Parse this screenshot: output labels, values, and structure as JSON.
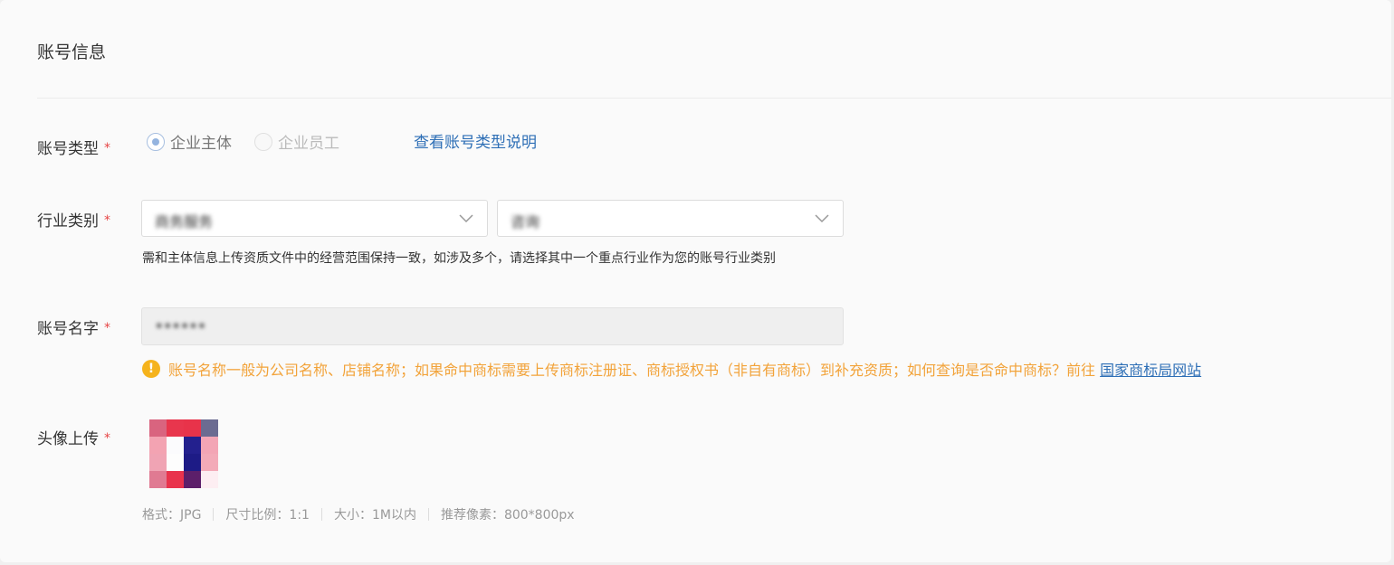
{
  "section": {
    "title": "账号信息"
  },
  "account_type": {
    "label": "账号类型",
    "required_mark": "*",
    "options": [
      {
        "label": "企业主体",
        "checked": true,
        "disabled": false
      },
      {
        "label": "企业员工",
        "checked": false,
        "disabled": true
      }
    ],
    "help_link": "查看账号类型说明"
  },
  "industry": {
    "label": "行业类别",
    "required_mark": "*",
    "primary_value": "商务服务",
    "secondary_value": "咨询",
    "hint": "需和主体信息上传资质文件中的经营范围保持一致，如涉及多个，请选择其中一个重点行业作为您的账号行业类别"
  },
  "account_name": {
    "label": "账号名字",
    "required_mark": "*",
    "value": "••••••",
    "warning_icon": "!",
    "warning_text": "账号名称一般为公司名称、店铺名称；如果命中商标需要上传商标注册证、商标授权书（非自有商标）到补充资质；如何查询是否命中商标？前往",
    "warning_link": "国家商标局网站"
  },
  "avatar_upload": {
    "label": "头像上传",
    "required_mark": "*",
    "format": "格式：JPG",
    "ratio": "尺寸比例：1:1",
    "size": "大小：1M以内",
    "recommended": "推荐像素：800*800px"
  },
  "colors": {
    "link": "#2e6fb6",
    "warning": "#f2a33a",
    "required": "#e64545",
    "avatar_pixels": [
      "#d9647f",
      "#e8364d",
      "#e8334a",
      "#6b6b91",
      "#f3a3b2",
      "#fbfbfd",
      "#23208e",
      "#f3a5b5",
      "#f0a4b4",
      "#fdfdfd",
      "#1d1b86",
      "#f3aab8",
      "#e07a92",
      "#e9334c",
      "#5c1f6a",
      "#fdeef2"
    ]
  }
}
